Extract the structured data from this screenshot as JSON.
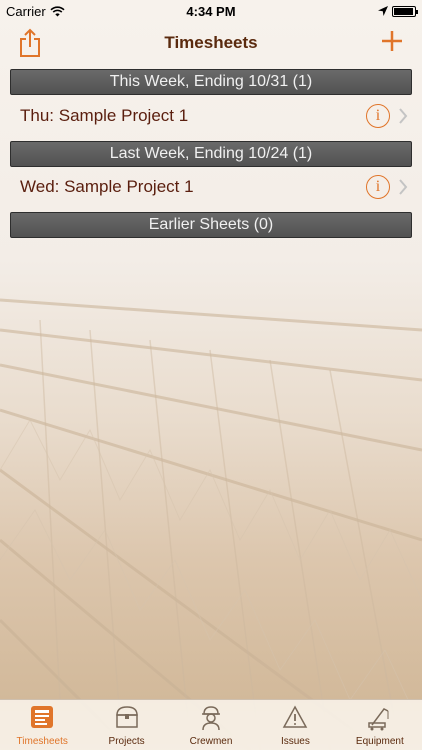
{
  "status_bar": {
    "carrier": "Carrier",
    "time": "4:34 PM",
    "battery_level": 0.95
  },
  "nav": {
    "title": "Timesheets",
    "share_icon": "share-icon",
    "add_icon": "plus-icon",
    "accent": "#e0752a"
  },
  "sections": [
    {
      "header": "This Week, Ending 10/31 (1)",
      "rows": [
        {
          "label": "Thu: Sample Project 1"
        }
      ]
    },
    {
      "header": "Last Week, Ending 10/24 (1)",
      "rows": [
        {
          "label": "Wed: Sample Project 1"
        }
      ]
    },
    {
      "header": "Earlier Sheets (0)",
      "rows": []
    }
  ],
  "info_glyph": "i",
  "tabs": [
    {
      "label": "Timesheets",
      "icon": "timesheet-icon",
      "active": true
    },
    {
      "label": "Projects",
      "icon": "chest-icon",
      "active": false
    },
    {
      "label": "Crewmen",
      "icon": "worker-icon",
      "active": false
    },
    {
      "label": "Issues",
      "icon": "warning-icon",
      "active": false
    },
    {
      "label": "Equipment",
      "icon": "crane-icon",
      "active": false
    }
  ]
}
